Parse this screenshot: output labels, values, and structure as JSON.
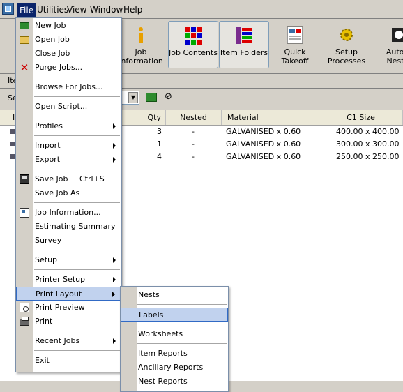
{
  "menubar": {
    "items": [
      {
        "label": "File"
      },
      {
        "label": "Utilities"
      },
      {
        "label": "View"
      },
      {
        "label": "Window"
      },
      {
        "label": "Help"
      }
    ]
  },
  "toolbar": {
    "buttons": [
      {
        "label": "Job Information",
        "icon": "info-icon"
      },
      {
        "label": "Job Contents",
        "icon": "grid-icon"
      },
      {
        "label": "Item Folders",
        "icon": "folders-icon"
      },
      {
        "label": "Quick Takeoff",
        "icon": "takeoff-icon"
      },
      {
        "label": "Setup Processes",
        "icon": "gear-icon"
      },
      {
        "label": "Autom Nestin",
        "icon": "nesting-icon"
      }
    ]
  },
  "subbar": {
    "label": "Ite"
  },
  "filterbar": {
    "label": "Se"
  },
  "grid": {
    "first_header": "I",
    "headers": [
      "Qty",
      "Nested",
      "Material",
      "C1 Size"
    ],
    "rows": [
      {
        "qty": "3",
        "nested": "-",
        "material": "GALVANISED x 0.60",
        "size": "400.00 x 400.00"
      },
      {
        "qty": "1",
        "nested": "-",
        "material": "GALVANISED x 0.60",
        "size": "300.00 x 300.00"
      },
      {
        "qty": "4",
        "nested": "-",
        "material": "GALVANISED x 0.60",
        "size": "250.00 x 250.00"
      }
    ]
  },
  "file_menu": {
    "items": [
      {
        "label": "New Job"
      },
      {
        "label": "Open Job"
      },
      {
        "label": "Close Job"
      },
      {
        "label": "Purge Jobs..."
      },
      {
        "label": "Browse For Jobs..."
      },
      {
        "label": "Open Script..."
      },
      {
        "label": "Profiles"
      },
      {
        "label": "Import"
      },
      {
        "label": "Export"
      },
      {
        "label": "Save Job",
        "shortcut": "Ctrl+S"
      },
      {
        "label": "Save Job As"
      },
      {
        "label": "Job Information..."
      },
      {
        "label": "Estimating Summary"
      },
      {
        "label": "Survey"
      },
      {
        "label": "Setup"
      },
      {
        "label": "Printer Setup"
      },
      {
        "label": "Print Layout"
      },
      {
        "label": "Print Preview"
      },
      {
        "label": "Print"
      },
      {
        "label": "Recent Jobs"
      },
      {
        "label": "Exit"
      }
    ]
  },
  "print_layout_menu": {
    "items": [
      {
        "label": "Nests"
      },
      {
        "label": "Labels"
      },
      {
        "label": "Worksheets"
      },
      {
        "label": "Item Reports"
      },
      {
        "label": "Ancillary Reports"
      },
      {
        "label": "Nest Reports"
      }
    ]
  },
  "colors": {
    "menu_highlight": "#c1d2ee",
    "menu_highlight_border": "#316ac5",
    "menubar_active": "#0a246a"
  }
}
